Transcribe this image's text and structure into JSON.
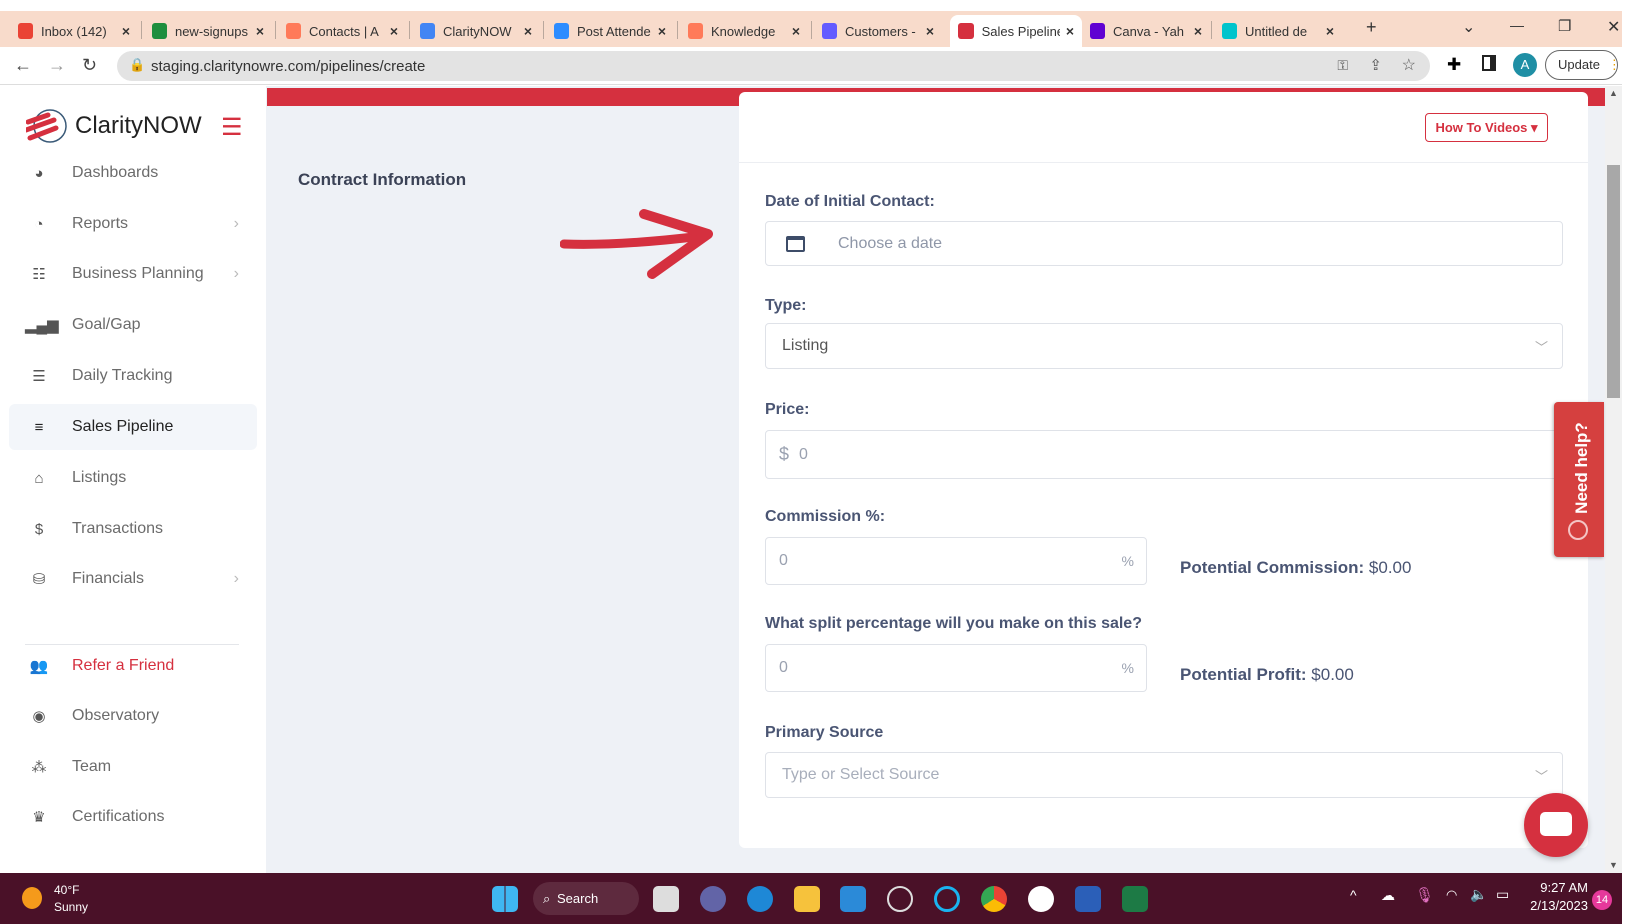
{
  "browser": {
    "tabs": [
      {
        "label": "Inbox (142)",
        "color": "#ea4335"
      },
      {
        "label": "new-signups",
        "color": "#1e8e3e"
      },
      {
        "label": "Contacts | A",
        "color": "#ff7a59"
      },
      {
        "label": "ClarityNOW",
        "color": "#4285f4"
      },
      {
        "label": "Post Attende",
        "color": "#2d8cff"
      },
      {
        "label": "Knowledge",
        "color": "#ff7a59"
      },
      {
        "label": "Customers -",
        "color": "#635bff"
      },
      {
        "label": "Sales Pipeline",
        "color": "#d5303f",
        "active": true
      },
      {
        "label": "Canva - Yah",
        "color": "#6001d2"
      },
      {
        "label": "Untitled de",
        "color": "#00c4cc"
      }
    ],
    "url": "staging.claritynowre.com/pipelines/create",
    "update_label": "Update",
    "profile_initial": "A"
  },
  "sidebar": {
    "brand": "ClarityNOW",
    "items": [
      {
        "label": "Dashboards",
        "icon": "gauge-icon",
        "glyph": "◕"
      },
      {
        "label": "Reports",
        "icon": "pie-chart-icon",
        "glyph": "◔",
        "chevron": true
      },
      {
        "label": "Business Planning",
        "icon": "checklist-icon",
        "glyph": "☷",
        "chevron": true
      },
      {
        "label": "Goal/Gap",
        "icon": "signal-bars-icon",
        "glyph": "▂▄▆"
      },
      {
        "label": "Daily Tracking",
        "icon": "list-icon",
        "glyph": "☰"
      },
      {
        "label": "Sales Pipeline",
        "icon": "bars-icon",
        "glyph": "≡",
        "active": true
      },
      {
        "label": "Listings",
        "icon": "home-icon",
        "glyph": "⌂"
      },
      {
        "label": "Transactions",
        "icon": "dollar-icon",
        "glyph": "$"
      },
      {
        "label": "Financials",
        "icon": "coins-icon",
        "glyph": "⛁",
        "chevron": true
      },
      {
        "label": "Refer a Friend",
        "icon": "users-icon",
        "glyph": "👥",
        "highlight": true
      },
      {
        "label": "Observatory",
        "icon": "eye-icon",
        "glyph": "◉"
      },
      {
        "label": "Team",
        "icon": "team-icon",
        "glyph": "⁂"
      },
      {
        "label": "Certifications",
        "icon": "crown-icon",
        "glyph": "♛"
      }
    ]
  },
  "page": {
    "section_title": "Contract Information",
    "how_to_videos": "How To Videos",
    "date_label": "Date of Initial Contact:",
    "date_placeholder": "Choose a date",
    "type_label": "Type:",
    "type_value": "Listing",
    "price_label": "Price:",
    "price_prefix": "$",
    "price_value": "0",
    "commission_label": "Commission %:",
    "commission_value": "0",
    "percent_symbol": "%",
    "potential_commission_label": "Potential Commission:",
    "potential_commission_value": "$0.00",
    "split_label": "What split percentage will you make on this sale?",
    "split_value": "0",
    "potential_profit_label": "Potential Profit:",
    "potential_profit_value": "$0.00",
    "source_label": "Primary Source",
    "source_placeholder": "Type or Select Source",
    "need_help": "Need help?"
  },
  "taskbar": {
    "temp": "40°F",
    "weather": "Sunny",
    "search": "Search",
    "time": "9:27 AM",
    "date": "2/13/2023",
    "notifications": "14"
  },
  "colors": {
    "accent": "#d5303f",
    "taskbar": "#4a1128",
    "tabbar": "#f8dbcb"
  }
}
